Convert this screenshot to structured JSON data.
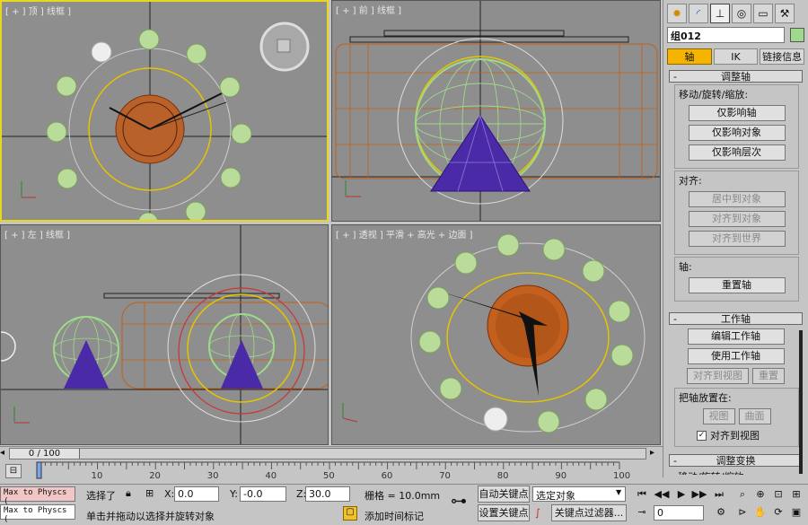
{
  "viewports": {
    "top": {
      "label": "[ + ] 顶 ] 线框 ]"
    },
    "front": {
      "label": "[ + ] 前 ] 线框 ]"
    },
    "left": {
      "label": "[ + ] 左 ] 线框 ]"
    },
    "persp": {
      "label": "[ + ] 透视 ] 平滑 + 高光 + 边面 ]"
    }
  },
  "panel": {
    "tab_icons": [
      "sun-icon",
      "curve-icon",
      "hierarchy-icon",
      "motion-icon",
      "display-icon",
      "utility-icon"
    ],
    "object_name": "组012",
    "swatch_color": "#9fd98a",
    "subtabs": [
      "轴",
      "IK",
      "链接信息"
    ],
    "adjust_pivot": {
      "title": "调整轴",
      "move_group": "移动/旋转/缩放:",
      "btn_affect_pivot": "仅影响轴",
      "btn_affect_object": "仅影响对象",
      "btn_affect_hierarchy": "仅影响层次",
      "align_group": "对齐:",
      "btn_center_to_object": "居中到对象",
      "btn_align_to_object": "对齐到对象",
      "btn_align_to_world": "对齐到世界",
      "pivot_group": "轴:",
      "btn_reset_pivot": "重置轴"
    },
    "working_pivot": {
      "title": "工作轴",
      "btn_edit": "编辑工作轴",
      "btn_use": "使用工作轴",
      "btn_align_to_view": "对齐到视图",
      "btn_reset": "重置",
      "place_group": "把轴放置在:",
      "btn_view": "视图",
      "btn_surface": "曲面",
      "check_align_view": "对齐到视图"
    },
    "adjust_transform": {
      "title": "调整变换",
      "partial": "移动/旋转/缩放:"
    }
  },
  "timeline": {
    "frame_display": "0 / 100",
    "ticks": [
      "10",
      "20",
      "30",
      "40",
      "50",
      "60",
      "70",
      "80",
      "90",
      "100"
    ]
  },
  "status": {
    "script_listener": "Max to Physcs (",
    "selected": "选择了",
    "x_value": "0.0",
    "y_value": "-0.0",
    "z_value": "30.0",
    "x_label": "X:",
    "y_label": "Y:",
    "z_label": "Z:",
    "grid": "栅格 = 10.0mm",
    "prompt": "单击并拖动以选择并旋转对象",
    "add_time_tag": "添加时间标记",
    "auto_key": "自动关键点",
    "set_key": "设置关键点",
    "selection_dropdown": "选定对象",
    "key_filters": "关键点过滤器...",
    "current_frame": "0"
  }
}
